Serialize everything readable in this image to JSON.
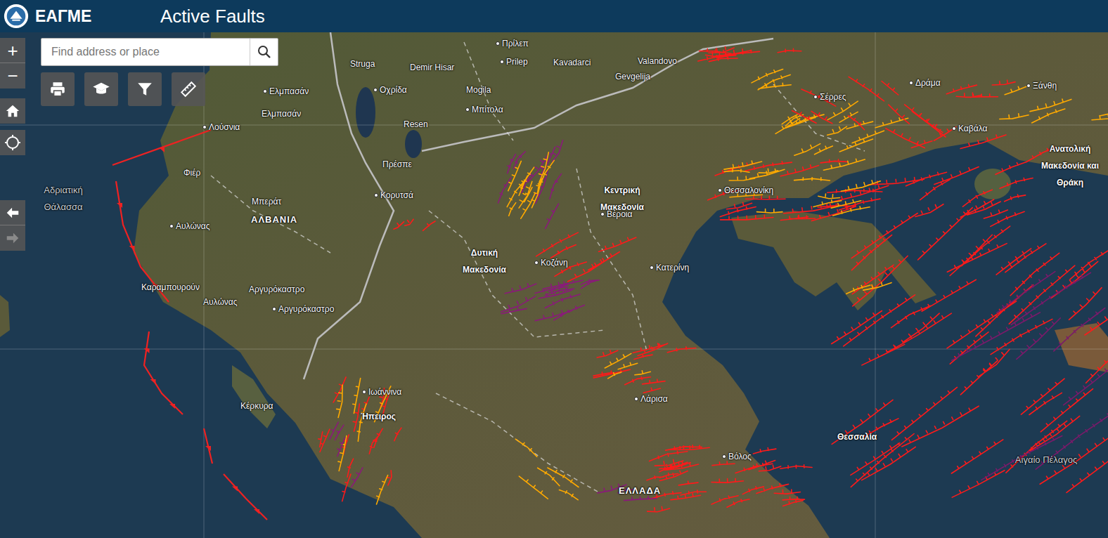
{
  "header": {
    "logo": "ΕΑΓΜΕ",
    "title": "Active Faults"
  },
  "search": {
    "placeholder": "Find address or place"
  },
  "zoom": {
    "in": "+",
    "out": "−"
  },
  "nav": {
    "back": {
      "disabled": false
    },
    "forward": {
      "disabled": true
    }
  },
  "labels": [
    {
      "text": "Πρίλεπ",
      "kind": "city"
    },
    {
      "text": "Struga",
      "kind": "town"
    },
    {
      "text": "Demir Hisar",
      "kind": "town"
    },
    {
      "text": "Prilep",
      "kind": "city"
    },
    {
      "text": "Kavadarci",
      "kind": "town"
    },
    {
      "text": "Valandovo",
      "kind": "town"
    },
    {
      "text": "Gevgelija",
      "kind": "town"
    },
    {
      "text": "Ελμπασάν",
      "kind": "city"
    },
    {
      "text": "Ελμπασάν",
      "kind": "town"
    },
    {
      "text": "Οχρίδα",
      "kind": "city"
    },
    {
      "text": "Mogila",
      "kind": "town"
    },
    {
      "text": "Μπίτολα",
      "kind": "city"
    },
    {
      "text": "Resen",
      "kind": "town"
    },
    {
      "text": "Λούσνια",
      "kind": "city"
    },
    {
      "text": "Πρέσπε",
      "kind": "town"
    },
    {
      "text": "Κορυτσά",
      "kind": "city"
    },
    {
      "text": "Φιέρ",
      "kind": "town"
    },
    {
      "text": "Μπεράτ",
      "kind": "town"
    },
    {
      "text": "ΑΛΒΑΝΙΑ",
      "kind": "country"
    },
    {
      "text": "Αυλώνας",
      "kind": "city"
    },
    {
      "text": "Αδριατική Θάλασσα",
      "kind": "sea"
    },
    {
      "text": "Κεντρική Μακεδονία",
      "kind": "region"
    },
    {
      "text": "Θεσσαλονίκη",
      "kind": "city"
    },
    {
      "text": "Βέροια",
      "kind": "city"
    },
    {
      "text": "Δυτική Μακεδονία",
      "kind": "region"
    },
    {
      "text": "Κοζάνη",
      "kind": "city"
    },
    {
      "text": "Κατερίνη",
      "kind": "city"
    },
    {
      "text": "Ανατολική Μακεδονία και Θράκη",
      "kind": "region"
    },
    {
      "text": "Σέρρες",
      "kind": "city"
    },
    {
      "text": "Δράμα",
      "kind": "city"
    },
    {
      "text": "Ξάνθη",
      "kind": "city"
    },
    {
      "text": "Καβάλα",
      "kind": "city"
    },
    {
      "text": "Καραμπουρούν",
      "kind": "town"
    },
    {
      "text": "Αργυρόκαστρο",
      "kind": "town"
    },
    {
      "text": "Αυλώνας",
      "kind": "town"
    },
    {
      "text": "Αργυρόκαστρο",
      "kind": "city"
    },
    {
      "text": "Ιωάννινα",
      "kind": "city"
    },
    {
      "text": "Ήπειρος",
      "kind": "region"
    },
    {
      "text": "Κέρκυρα",
      "kind": "town"
    },
    {
      "text": "Λάρισα",
      "kind": "city"
    },
    {
      "text": "Θεσσαλία",
      "kind": "region"
    },
    {
      "text": "Βόλος",
      "kind": "city"
    },
    {
      "text": "ΕΛΛΑΔΑ",
      "kind": "country"
    },
    {
      "text": "Αιγαίο Πέλαγος",
      "kind": "sea"
    }
  ]
}
